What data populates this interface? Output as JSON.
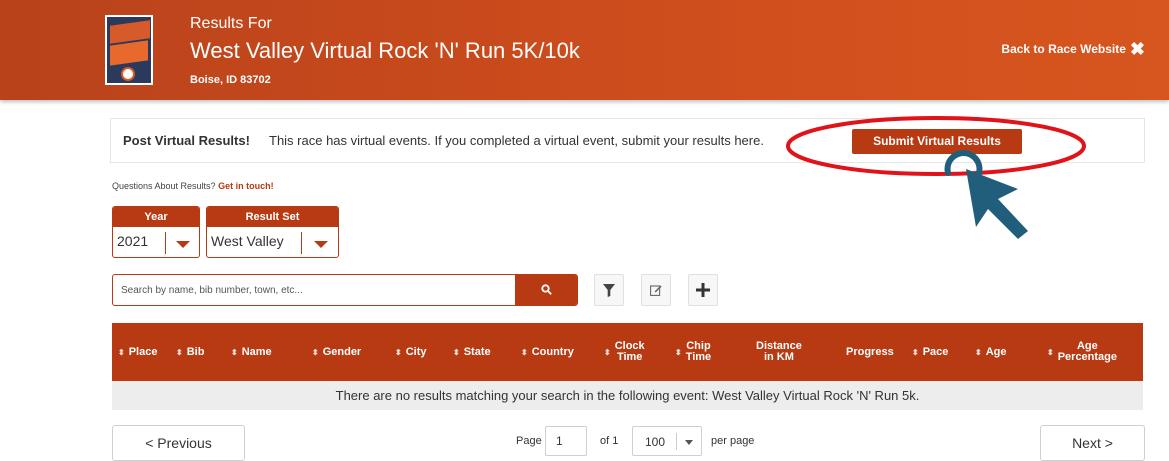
{
  "header": {
    "results_for": "Results For",
    "race_title": "West Valley Virtual Rock 'N' Run 5K/10k",
    "location": "Boise, ID 83702",
    "back_link": "Back to Race Website",
    "logo": "race-logo",
    "background": "#c9491c"
  },
  "notice": {
    "bold": "Post Virtual Results!",
    "text": "This race has virtual events. If you completed a virtual event, submit your results here.",
    "submit_button": "Submit Virtual Results"
  },
  "questions": {
    "text": "Questions About Results?",
    "link": "Get in touch!"
  },
  "filters": {
    "year": {
      "title": "Year",
      "value": "2021"
    },
    "result_set": {
      "title": "Result Set",
      "value": "West Valley"
    }
  },
  "search": {
    "placeholder": "Search by name, bib number, town, etc...",
    "icon": "search-icon"
  },
  "tools": [
    "filter-icon",
    "edit-icon",
    "plus-icon"
  ],
  "table": {
    "columns": [
      {
        "label": "Place",
        "sortable": true
      },
      {
        "label": "Bib",
        "sortable": true
      },
      {
        "label": "Name",
        "sortable": true
      },
      {
        "label": "Gender",
        "sortable": true
      },
      {
        "label": "City",
        "sortable": true
      },
      {
        "label": "State",
        "sortable": true
      },
      {
        "label": "Country",
        "sortable": true
      },
      {
        "label_line1": "Clock",
        "label_line2": "Time",
        "sortable": true
      },
      {
        "label_line1": "Chip",
        "label_line2": "Time",
        "sortable": true
      },
      {
        "label_line1": "Distance",
        "label_line2": "in KM",
        "sortable": false
      },
      {
        "label": "Progress",
        "sortable": false
      },
      {
        "label": "Pace",
        "sortable": true
      },
      {
        "label": "Age",
        "sortable": true
      },
      {
        "label_line1": "Age",
        "label_line2": "Percentage",
        "sortable": true
      }
    ],
    "empty_message": "There are no results matching your search in the following event: West Valley Virtual Rock 'N' Run 5k."
  },
  "pagination": {
    "previous": "< Previous",
    "next": "Next >",
    "page_label": "Page",
    "page_value": "1",
    "of_label": "of 1",
    "per_page_value": "100",
    "per_page_label": "per page"
  },
  "colors": {
    "accent": "#b83a13",
    "annotation_ellipse": "#e0131b",
    "annotation_cursor": "#215e7c"
  }
}
